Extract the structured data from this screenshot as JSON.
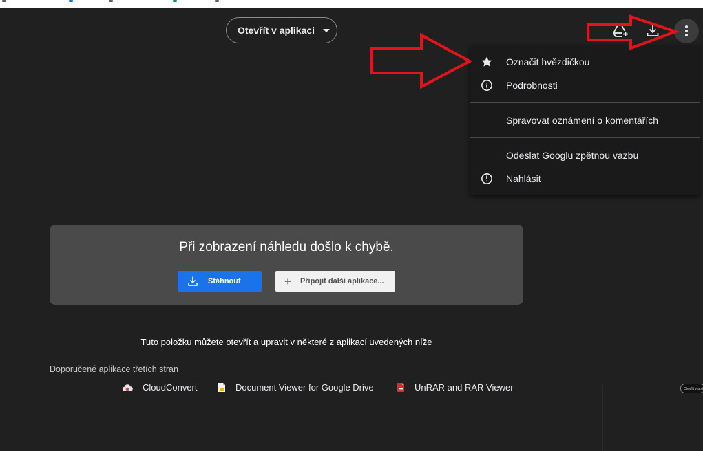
{
  "toolbar": {
    "open_in_app_label": "Otevřít v aplikaci",
    "add_to_drive_icon": "add-to-drive-icon",
    "download_icon": "download-icon",
    "more_icon": "more-vert-icon"
  },
  "menu": {
    "items": [
      {
        "label": "Označit hvězdičkou",
        "icon": "star-icon"
      },
      {
        "label": "Podrobnosti",
        "icon": "info-icon"
      },
      {
        "label": "Spravovat oznámení o komentářích",
        "icon": ""
      },
      {
        "label": "Odeslat Googlu zpětnou vazbu",
        "icon": ""
      },
      {
        "label": "Nahlásit",
        "icon": "report-icon"
      }
    ]
  },
  "preview_error": {
    "title": "Při zobrazení náhledu došlo k chybě.",
    "download_label": "Stáhnout",
    "connect_label": "Připojit další aplikace..."
  },
  "open_info": "Tuto položku můžete otevřít a upravit v některé z aplikací uvedených níže",
  "third_party": {
    "heading": "Doporučené aplikace třetích stran",
    "apps": [
      {
        "label": "CloudConvert",
        "icon": "cloudconvert-icon"
      },
      {
        "label": "Document Viewer for Google Drive",
        "icon": "document-viewer-icon"
      },
      {
        "label": "UnRAR and RAR Viewer",
        "icon": "unrar-icon"
      }
    ]
  },
  "tooltip_text": "Otevřít v aplikaci",
  "colors": {
    "background": "#202020",
    "accent_blue": "#1a73e8",
    "annotation_red": "#e0141a"
  }
}
